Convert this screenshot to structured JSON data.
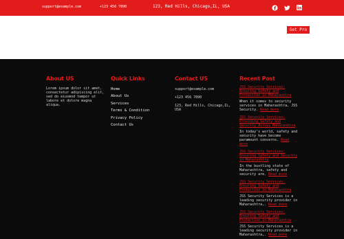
{
  "topbar": {
    "email": "support@example.com",
    "phone": "+123 456 7890",
    "address": "123, Red Hills, Chicago,IL, USA",
    "social": [
      "facebook-icon",
      "twitter-icon",
      "linkedin-icon"
    ]
  },
  "header": {
    "get_pro": "Get Pro"
  },
  "footer": {
    "about": {
      "title": "About US",
      "text": "Lorem ipsum dolor sit amet, consectetur adipiscing elit, sed do eiusmod tempor ut labore et dolore magna aliqua."
    },
    "quick_links": {
      "title": "Quick Links",
      "items": [
        "Home",
        "About Us",
        "Services",
        "Terms & Condition",
        "Privacy Policy",
        "Contact Us"
      ]
    },
    "contact": {
      "title": "Contact US",
      "email": "support@example.com",
      "phone": "+123 456 7890",
      "address": "123, Red Hills, Chicago,IL, USA"
    },
    "recent": {
      "title": "Recent Post",
      "posts": [
        {
          "title": "JSS Security Services: Ensuring Safety and Protection in Maharashtra",
          "excerpt": "When it comes to security services in Maharashtra, JSS Security.",
          "more": "Read more"
        },
        {
          "title": "JSS Security Services: Providing Safety and Security Across Maharashtra",
          "excerpt": "In today's world, safety and security have become paramount concerns.",
          "more": "Read more"
        },
        {
          "title": "JSS Security Services: Ensuring Safety and Security in Maharashtra",
          "excerpt": "In the bustling state of Maharashtra, safety and security are.",
          "more": "Read more"
        },
        {
          "title": "JSS Security Services: Ensuring Safety and Protection in Maharashtra",
          "excerpt": "JSS Security Services is a leading security provider in Maharashtra,.",
          "more": "Read more"
        },
        {
          "title": "JSS Security Services: Ensuring Safety and Protection in Maharashtra",
          "excerpt": "JSS Security Services is a leading security provider in Maharashtra,.",
          "more": "Read more"
        }
      ]
    }
  },
  "colors": {
    "accent": "#e21b1b",
    "footer_bg": "#0b0b0b"
  }
}
